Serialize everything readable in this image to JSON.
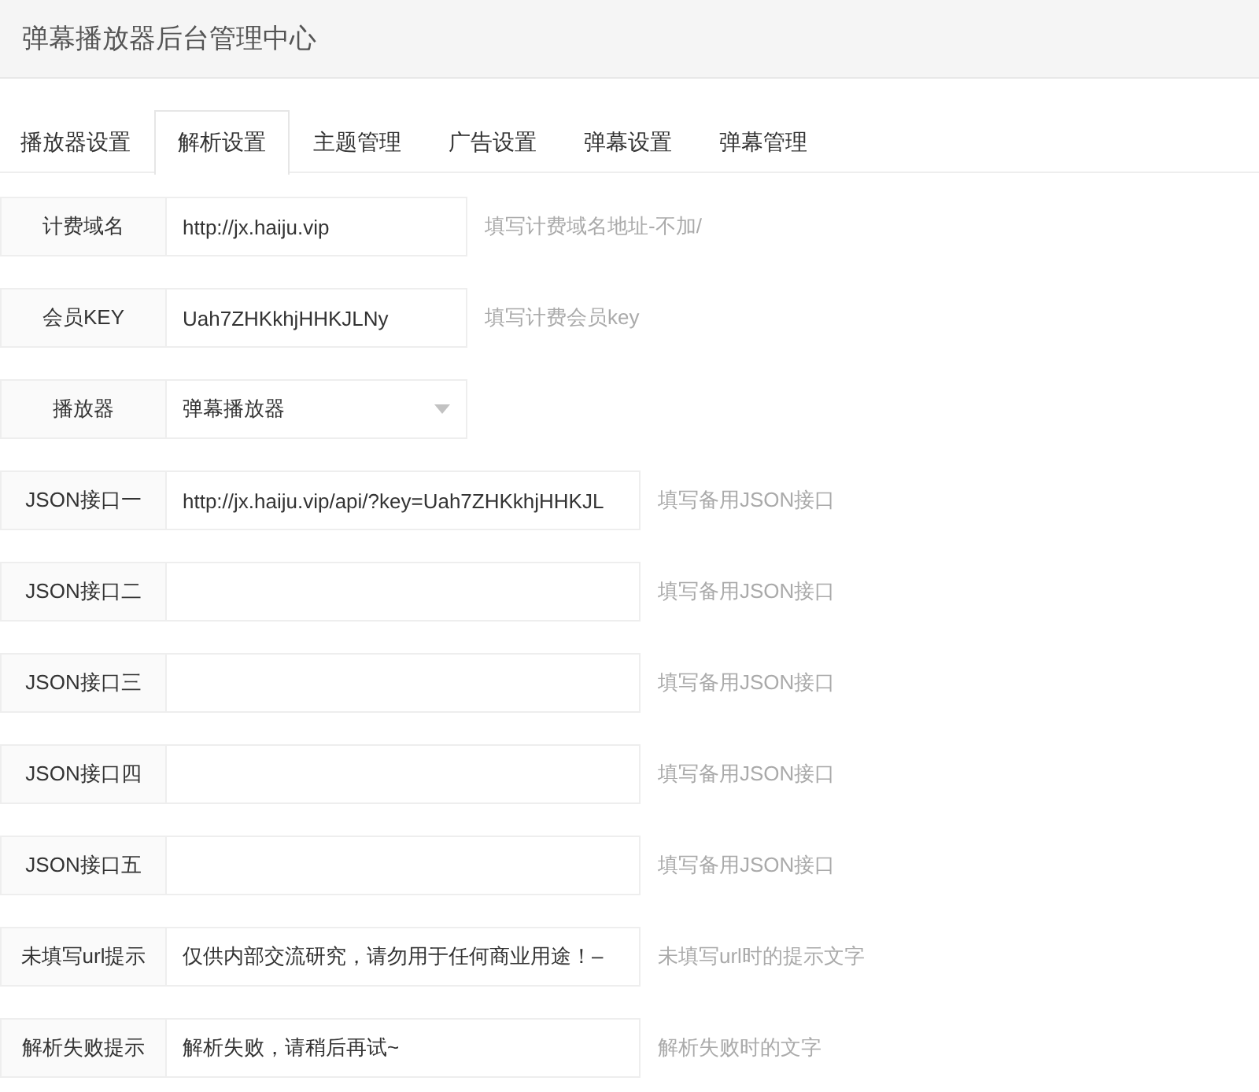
{
  "header": {
    "title": "弹幕播放器后台管理中心"
  },
  "tabs": [
    {
      "label": "播放器设置",
      "selected": false
    },
    {
      "label": "解析设置",
      "selected": true
    },
    {
      "label": "主题管理",
      "selected": false
    },
    {
      "label": "广告设置",
      "selected": false
    },
    {
      "label": "弹幕设置",
      "selected": false
    },
    {
      "label": "弹幕管理",
      "selected": false
    }
  ],
  "form": [
    {
      "label": "计费域名",
      "kind": "input",
      "value": "http://jx.haiju.vip",
      "hint": "填写计费域名地址-不加/"
    },
    {
      "label": "会员KEY",
      "kind": "input",
      "value": "Uah7ZHKkhjHHKJLNy",
      "hint": "填写计费会员key"
    },
    {
      "label": "播放器",
      "kind": "select",
      "value": "弹幕播放器"
    },
    {
      "label": "JSON接口一",
      "kind": "input",
      "value": "http://jx.haiju.vip/api/?key=Uah7ZHKkhjHHKJL",
      "hint": "填写备用JSON接口"
    },
    {
      "label": "JSON接口二",
      "kind": "input",
      "hint": "填写备用JSON接口"
    },
    {
      "label": "JSON接口三",
      "kind": "input",
      "hint": "填写备用JSON接口"
    },
    {
      "label": "JSON接口四",
      "kind": "input",
      "hint": "填写备用JSON接口"
    },
    {
      "label": "JSON接口五",
      "kind": "input",
      "hint": "填写备用JSON接口"
    },
    {
      "label": "未填写url提示",
      "kind": "input",
      "value": "仅供内部交流研究，请勿用于任何商业用途！–",
      "hint": "未填写url时的提示文字"
    },
    {
      "label": "解析失败提示",
      "kind": "input",
      "value": "解析失败，请稍后再试~",
      "hint": "解析失败时的文字"
    }
  ]
}
